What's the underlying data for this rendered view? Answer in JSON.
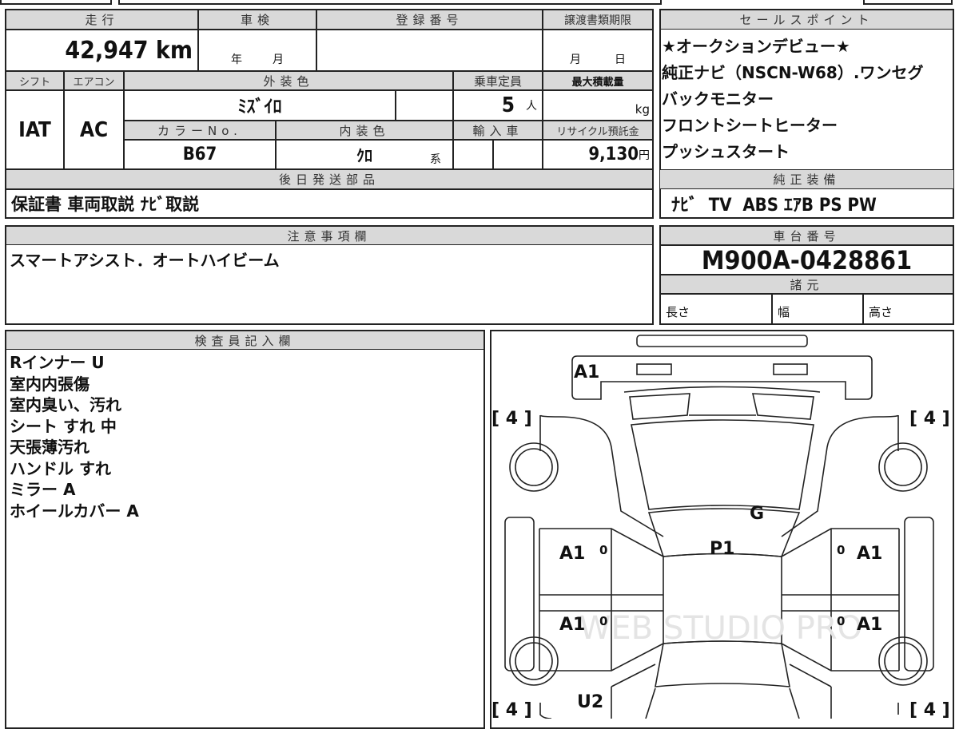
{
  "vehicle": {
    "mileage_label": "走行",
    "mileage": "42,947 km",
    "inspection_label": "車検",
    "inspection_year": "年",
    "inspection_month": "月",
    "registration_label": "登録番号",
    "transfer_label": "譲渡書類期限",
    "transfer_month": "月",
    "transfer_day": "日",
    "shift_label": "シフト",
    "shift": "IAT",
    "ac_label": "エアコン",
    "ac": "AC",
    "exterior_label": "外装色",
    "exterior": "ﾐｽﾞｲﾛ",
    "capacity_label": "乗車定員",
    "capacity": "5",
    "capacity_unit": "人",
    "load_label": "最大積載量",
    "load_unit": "kg",
    "color_no_label": "カラーNo.",
    "color_no": "B67",
    "interior_label": "内装色",
    "interior": "ｸﾛ",
    "interior_suffix": "系",
    "import_label": "輸入車",
    "recycle_label": "リサイクル預託金",
    "recycle": "9,130",
    "recycle_unit": "円",
    "later_parts_label": "後日発送部品",
    "later_parts": "保証書 車両取説 ﾅﾋﾞ取説"
  },
  "sales_points": {
    "label": "セールスポイント",
    "items": [
      "★オークションデビュー★",
      "純正ナビ（NSCN-W68）.ワンセグ",
      "バックモニター",
      "フロントシートヒーター",
      "プッシュスタート"
    ]
  },
  "equipment": {
    "label": "純正装備",
    "value": "ﾅﾋﾞ  TV  ABS ｴｱB PS PW"
  },
  "notes": {
    "label": "注意事項欄",
    "value": "スマートアシスト．オートハイビーム"
  },
  "chassis": {
    "label": "車台番号",
    "value": "M900A-0428861",
    "spec_label": "諸元",
    "length": "長さ",
    "width": "幅",
    "height": "高さ"
  },
  "inspector": {
    "label": "検査員記入欄",
    "items": [
      "Rインナー U",
      "室内内張傷",
      "室内臭い、汚れ",
      "シート すれ 中",
      "天張薄汚れ",
      "ハンドル すれ",
      "ミラー A",
      "ホイールカバー A"
    ]
  },
  "diagram": {
    "front": "A1",
    "tire_fl": "[ 4 ]",
    "tire_fr": "[ 4 ]",
    "tire_rl": "[ 4 ]",
    "tire_rr": "[ 4 ]",
    "windshield": "G",
    "roof": "P1",
    "door_fl": "A1",
    "door_rl": "A1",
    "door_fr": "A1",
    "door_rr": "A1",
    "zero": "0",
    "rear_left": "U2",
    "watermark": "WEB STUDIO PRO"
  }
}
